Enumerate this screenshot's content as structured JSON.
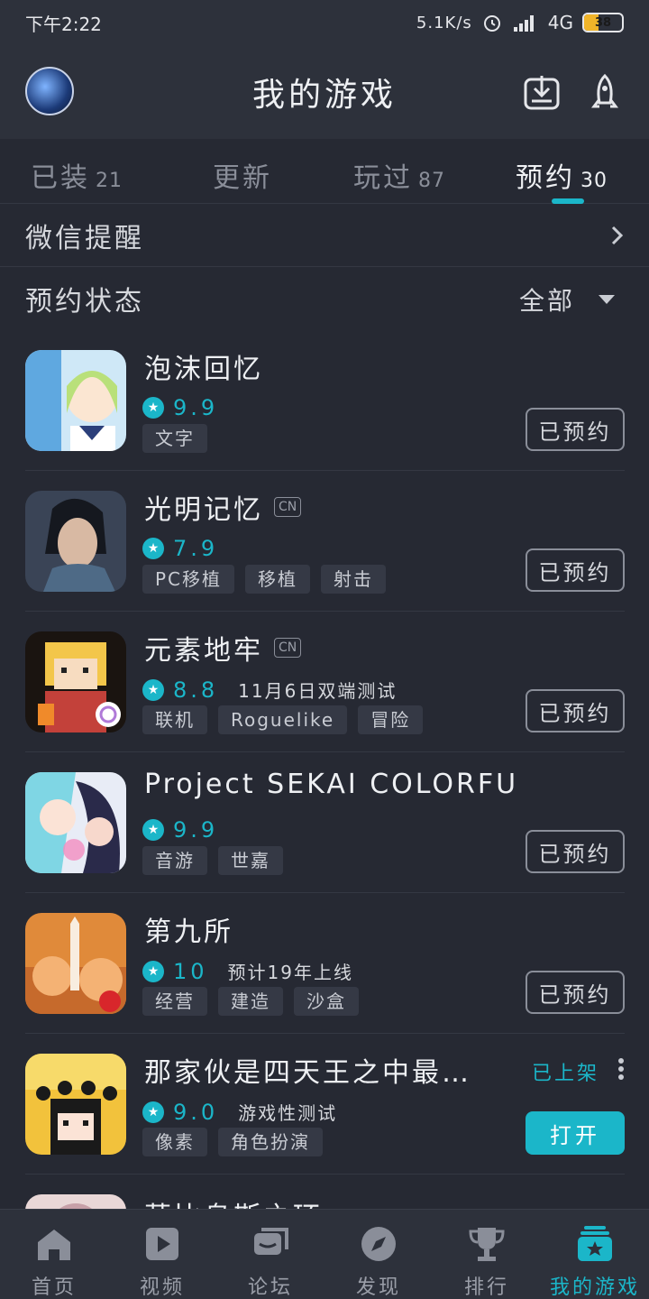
{
  "status_bar": {
    "time": "下午2:22",
    "net_speed": "5.1K/s",
    "signal": "4G",
    "battery": "38",
    "battery_level": 0.38
  },
  "header": {
    "title": "我的游戏",
    "left_icon": "avatar",
    "right_icons": [
      "download-icon",
      "rocket-icon"
    ]
  },
  "tabs": [
    {
      "label": "已装",
      "count": "21"
    },
    {
      "label": "更新",
      "count": ""
    },
    {
      "label": "玩过",
      "count": "87"
    },
    {
      "label": "预约",
      "count": "30",
      "active": true
    }
  ],
  "wechat_reminder": {
    "label": "微信提醒"
  },
  "reservation_filter": {
    "label": "预约状态",
    "value": "全部"
  },
  "games": [
    {
      "title": "泡沫回忆",
      "cn": "",
      "score": "9.9",
      "note": "",
      "tags": [
        "文字"
      ],
      "action": "已预约"
    },
    {
      "title": "光明记忆",
      "cn": "CN",
      "score": "7.9",
      "note": "",
      "tags": [
        "PC移植",
        "移植",
        "射击"
      ],
      "action": "已预约"
    },
    {
      "title": "元素地牢",
      "cn": "CN",
      "score": "8.8",
      "note": "11月6日双端测试",
      "tags": [
        "联机",
        "Roguelike",
        "冒险"
      ],
      "action": "已预约"
    },
    {
      "title": "Project SEKAI COLORFU…",
      "cn": "",
      "score": "9.9",
      "note": "",
      "tags": [
        "音游",
        "世嘉"
      ],
      "action": "已预约"
    },
    {
      "title": "第九所",
      "cn": "",
      "score": "10",
      "note": "预计19年上线",
      "tags": [
        "经营",
        "建造",
        "沙盒"
      ],
      "action": "已预约"
    },
    {
      "title": "那家伙是四天王之中最…",
      "cn": "",
      "score": "9.0",
      "note": "游戏性测试",
      "tags": [
        "像素",
        "角色扮演"
      ],
      "action": "打开",
      "status": "已上架"
    }
  ],
  "partial_game": {
    "title": "莫比乌斯之环"
  },
  "bottom_nav": [
    {
      "label": "首页",
      "icon": "home-icon"
    },
    {
      "label": "视频",
      "icon": "play-icon"
    },
    {
      "label": "论坛",
      "icon": "forum-icon"
    },
    {
      "label": "发现",
      "icon": "compass-icon"
    },
    {
      "label": "排行",
      "icon": "trophy-icon"
    },
    {
      "label": "我的游戏",
      "icon": "my-games-icon",
      "active": true
    }
  ],
  "colors": {
    "accent": "#1bb6c9",
    "background": "#262933",
    "bar": "#2d313b"
  }
}
